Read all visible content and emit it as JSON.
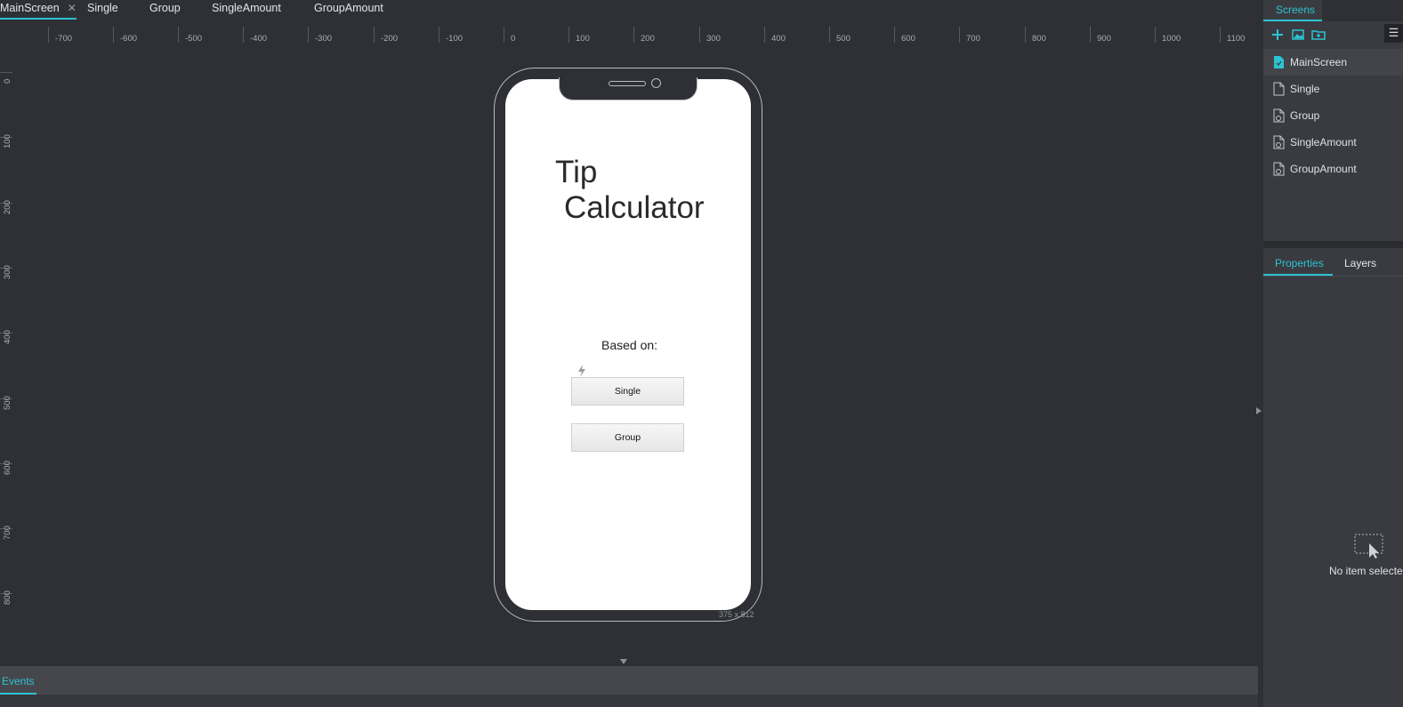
{
  "top_tabs": [
    {
      "label": "MainScreen",
      "active": true
    },
    {
      "label": "Single"
    },
    {
      "label": "Group"
    },
    {
      "label": "SingleAmount"
    },
    {
      "label": "GroupAmount"
    }
  ],
  "close_glyph": "✕",
  "hruler_labels": [
    "-700",
    "-600",
    "-500",
    "-400",
    "-300",
    "-200",
    "-100",
    "0",
    "100",
    "200",
    "300",
    "400",
    "500",
    "600",
    "700",
    "800",
    "900",
    "1000",
    "1100"
  ],
  "vruler_labels": [
    "0",
    "100",
    "200",
    "300",
    "400",
    "500",
    "600",
    "700",
    "800"
  ],
  "app": {
    "title_line1": "Tip",
    "title_line2": "Calculator",
    "based_on": "Based on:",
    "single_button": "Single",
    "group_button": "Group",
    "screen_size": "375 x 812"
  },
  "events_tab": "Events",
  "right_panel": {
    "screens_tab": "Screens",
    "menu_glyph": "☰",
    "screens": [
      {
        "label": "MainScreen",
        "active": true
      },
      {
        "label": "Single"
      },
      {
        "label": "Group"
      },
      {
        "label": "SingleAmount"
      },
      {
        "label": "GroupAmount"
      }
    ],
    "properties_tab": "Properties",
    "layers_tab": "Layers",
    "no_item_text": "No item selected"
  },
  "colors": {
    "accent": "#2cc3d2",
    "canvas_bg": "#2f3035",
    "panel_bg": "#3a3b40"
  }
}
